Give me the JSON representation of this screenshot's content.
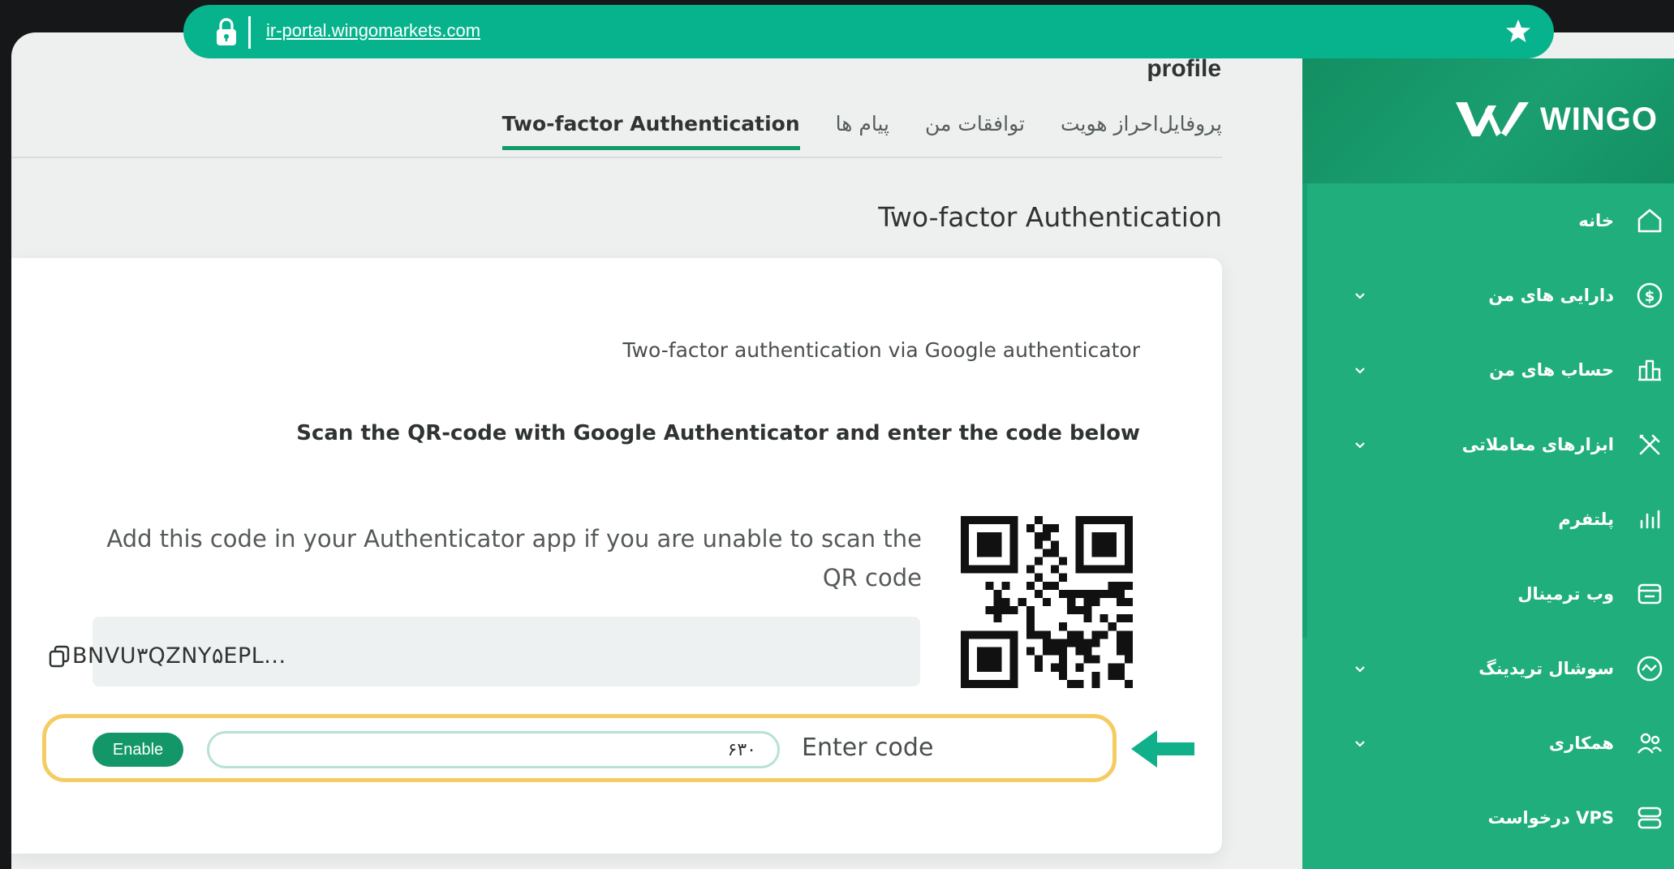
{
  "browser": {
    "url": "ir-portal.wingomarkets.com",
    "lock_icon": "lock-icon",
    "star_icon": "star-icon"
  },
  "header": {
    "profile_title": "profile",
    "tabs": [
      {
        "label": "پروفایل"
      },
      {
        "label": "احراز هویت"
      },
      {
        "label": "توافقات من"
      },
      {
        "label": "پیام ها"
      },
      {
        "label": "Two-factor Authentication",
        "active": true
      }
    ]
  },
  "main": {
    "section_title": "Two-factor Authentication",
    "subtitle": "Two-factor authentication via Google authenticator",
    "instruction": "Scan the QR-code with Google Authenticator and enter the code below",
    "manual_text": "Add this code in your Authenticator app if you are unable to scan the QR code",
    "secret_code": "BNVU۳QZNY۵EPL...",
    "code_label": "Enter code",
    "code_value": "۶۳۰",
    "enable_label": "Enable"
  },
  "sidebar": {
    "logo_text": "WINGO",
    "items": [
      {
        "label": "خانه",
        "icon": "home-icon",
        "has_dropdown": false
      },
      {
        "label": "دارایی های من",
        "icon": "dollar-icon",
        "has_dropdown": true
      },
      {
        "label": "حساب های من",
        "icon": "accounts-icon",
        "has_dropdown": true
      },
      {
        "label": "ابزارهای معاملاتی",
        "icon": "tools-icon",
        "has_dropdown": true
      },
      {
        "label": "پلتفرم",
        "icon": "chart-icon",
        "has_dropdown": false
      },
      {
        "label": "وب ترمینال",
        "icon": "terminal-icon",
        "has_dropdown": false
      },
      {
        "label": "سوشال تریدینگ",
        "icon": "social-icon",
        "has_dropdown": true
      },
      {
        "label": "همکاری",
        "icon": "partners-icon",
        "has_dropdown": true
      },
      {
        "label": "درخواست VPS",
        "icon": "server-icon",
        "has_dropdown": false
      }
    ]
  },
  "colors": {
    "brand_green": "#07b38d",
    "sidebar_green": "#1fae7c",
    "button_green": "#139768",
    "highlight_yellow": "#f5cc62"
  }
}
